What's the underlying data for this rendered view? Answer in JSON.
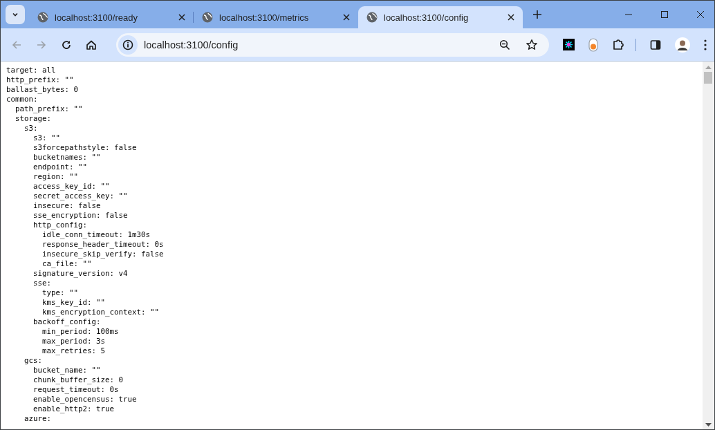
{
  "tabs": [
    {
      "title": "localhost:3100/ready",
      "selected": false
    },
    {
      "title": "localhost:3100/metrics",
      "selected": false
    },
    {
      "title": "localhost:3100/config",
      "selected": true
    }
  ],
  "address_bar": {
    "url": "localhost:3100/config"
  },
  "document": {
    "lines": [
      {
        "text": "target: all"
      },
      {
        "text": "http_prefix: \"\""
      },
      {
        "text": "ballast_bytes: 0"
      },
      {
        "text": "common:",
        "children": [
          {
            "text": "path_prefix: \"\""
          },
          {
            "text": "storage:",
            "children": [
              {
                "text": "s3:",
                "children": [
                  {
                    "text": "s3: \"\""
                  },
                  {
                    "text": "s3forcepathstyle: false"
                  },
                  {
                    "text": "bucketnames: \"\""
                  },
                  {
                    "text": "endpoint: \"\""
                  },
                  {
                    "text": "region: \"\""
                  },
                  {
                    "text": "access_key_id: \"\""
                  },
                  {
                    "text": "secret_access_key: \"\""
                  },
                  {
                    "text": "insecure: false"
                  },
                  {
                    "text": "sse_encryption: false"
                  },
                  {
                    "text": "http_config:",
                    "children": [
                      {
                        "text": "idle_conn_timeout: 1m30s"
                      },
                      {
                        "text": "response_header_timeout: 0s"
                      },
                      {
                        "text": "insecure_skip_verify: false"
                      },
                      {
                        "text": "ca_file: \"\""
                      }
                    ]
                  },
                  {
                    "text": "signature_version: v4"
                  },
                  {
                    "text": "sse:",
                    "children": [
                      {
                        "text": "type: \"\""
                      },
                      {
                        "text": "kms_key_id: \"\""
                      },
                      {
                        "text": "kms_encryption_context: \"\""
                      }
                    ]
                  },
                  {
                    "text": "backoff_config:",
                    "children": [
                      {
                        "text": "min_period: 100ms"
                      },
                      {
                        "text": "max_period: 3s"
                      },
                      {
                        "text": "max_retries: 5"
                      }
                    ]
                  }
                ]
              },
              {
                "text": "gcs:",
                "children": [
                  {
                    "text": "bucket_name: \"\""
                  },
                  {
                    "text": "chunk_buffer_size: 0"
                  },
                  {
                    "text": "request_timeout: 0s"
                  },
                  {
                    "text": "enable_opencensus: true"
                  },
                  {
                    "text": "enable_http2: true"
                  }
                ]
              },
              {
                "text": "azure:"
              }
            ]
          }
        ]
      }
    ]
  }
}
